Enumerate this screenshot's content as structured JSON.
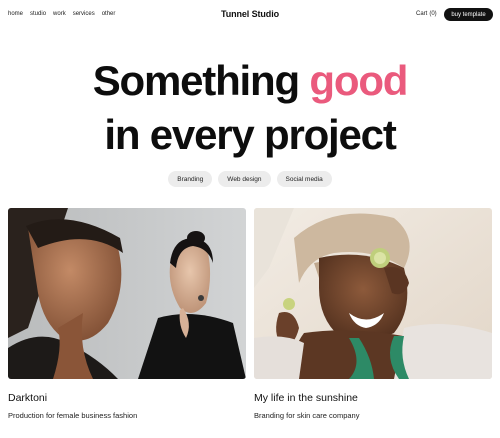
{
  "nav": {
    "links": [
      "home",
      "studio",
      "work",
      "services",
      "other"
    ],
    "brand": "Tunnel Studio",
    "cart_label": "Cart",
    "cart_count": "(0)",
    "buy_label": "buy template"
  },
  "hero": {
    "line1_prefix": "Something",
    "line1_accent": "good",
    "line2": "in every project",
    "accent_color": "#ea5a7d"
  },
  "tags": [
    "Branding",
    "Web design",
    "Social media"
  ],
  "projects": [
    {
      "title": "Darktoni",
      "subtitle": "Production for female business fashion",
      "image": "two-women-portrait-photo"
    },
    {
      "title": "My life in the sunshine",
      "subtitle": "Branding for skin care company",
      "image": "woman-spa-cucumber-photo"
    }
  ]
}
